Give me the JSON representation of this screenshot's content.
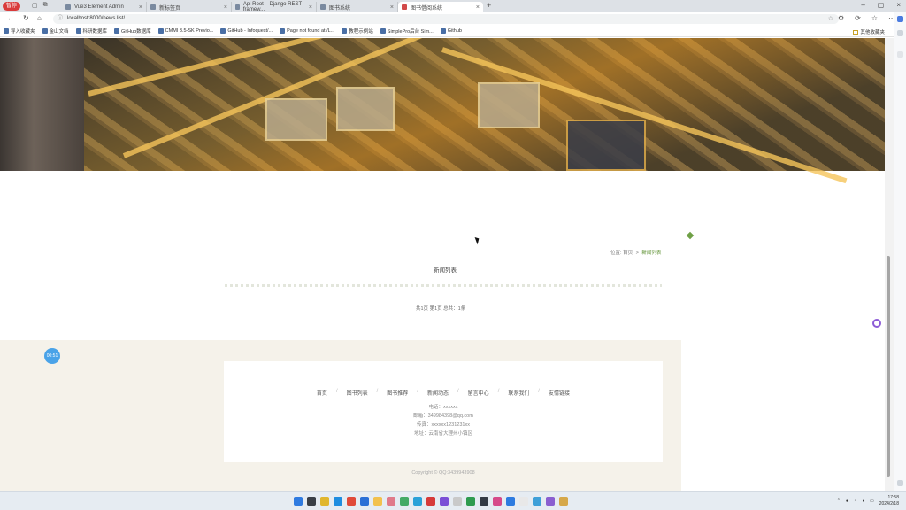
{
  "browser": {
    "profile_label": "暂停",
    "tabs": [
      {
        "title": "Vue3 Element Admin",
        "active": false
      },
      {
        "title": "新标签页",
        "active": false
      },
      {
        "title": "Api Root – Django REST framew...",
        "active": false
      },
      {
        "title": "图书系统",
        "active": false
      },
      {
        "title": "图书借阅系统",
        "active": true
      }
    ],
    "url": "localhost:8000/news.list/",
    "bookmarks": [
      "导入收藏夹",
      "金山文档",
      "科研数据库",
      "GitHub数据库",
      "CMMI 3.5-SK Previo...",
      "GitHub - Infoquest/...",
      "Page not found at /L...",
      "教程示例站",
      "SimplePro后台 Sim...",
      "Github"
    ],
    "bookmarks_right": "其他收藏夹"
  },
  "page": {
    "breadcrumb": {
      "label": "位置:",
      "home": "首页",
      "separator": ">",
      "current": "新闻列表"
    },
    "section_title": "新闻列表",
    "pagination": "共1页  第1页  总共：1条",
    "footer": {
      "nav": [
        "首页",
        "图书列表",
        "图书推荐",
        "新闻动态",
        "留言中心",
        "联系我们",
        "友情链接"
      ],
      "phone": "电话：xxxxxx",
      "email": "邮箱：349984398@qq.com",
      "fax": "传真：xxxxxx1231231xx",
      "address": "地址：云南省大理州小镇区",
      "copyright": "Copyright © QQ:3439943908"
    },
    "timer_badge": "00:51"
  },
  "taskbar": {
    "time": "17:58",
    "date": "2024/2/18"
  }
}
